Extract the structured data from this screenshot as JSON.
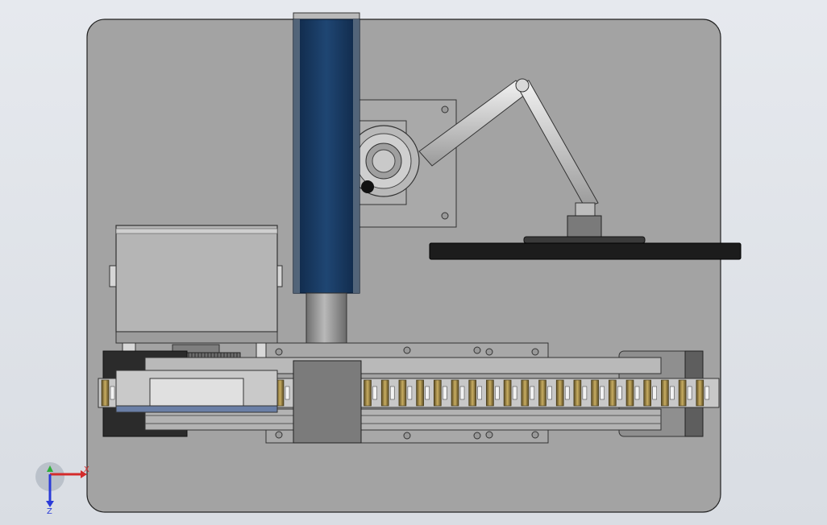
{
  "viewport": {
    "background": "#dfe3e8"
  },
  "model": {
    "base_plate_color": "#a3a3a3",
    "column_color": "#1b3a63",
    "monitor_color": "#1c1c1c",
    "rail_color": "#c8c8c8",
    "roller_color": "#a08a4c"
  },
  "triad": {
    "x_label": "X",
    "z_label": "Z",
    "x_color": "#d42b2b",
    "y_color": "#2fae3b",
    "z_color": "#2a3bd8"
  }
}
